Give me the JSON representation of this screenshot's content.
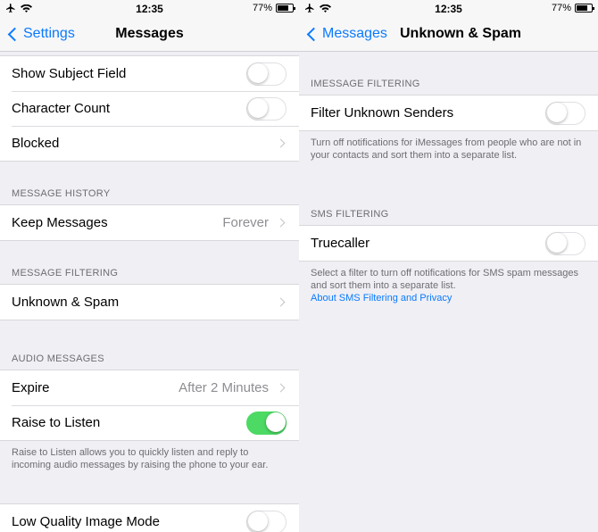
{
  "status_bar": {
    "time": "12:35",
    "battery": "77%",
    "battery_level": 0.77,
    "icons": [
      "airplane-icon",
      "wifi-icon",
      "battery-icon"
    ]
  },
  "left": {
    "nav": {
      "back_label": "Settings",
      "title": "Messages"
    },
    "top_group": [
      {
        "label": "Show Subject Field",
        "control": "toggle",
        "on": false
      },
      {
        "label": "Character Count",
        "control": "toggle",
        "on": false
      },
      {
        "label": "Blocked",
        "control": "chevron"
      }
    ],
    "message_history": {
      "header": "MESSAGE HISTORY",
      "rows": [
        {
          "label": "Keep Messages",
          "value": "Forever",
          "control": "chevron"
        }
      ]
    },
    "message_filtering": {
      "header": "MESSAGE FILTERING",
      "rows": [
        {
          "label": "Unknown & Spam",
          "control": "chevron"
        }
      ]
    },
    "audio_messages": {
      "header": "AUDIO MESSAGES",
      "rows": [
        {
          "label": "Expire",
          "value": "After 2 Minutes",
          "control": "chevron"
        },
        {
          "label": "Raise to Listen",
          "control": "toggle",
          "on": true
        }
      ],
      "footer": "Raise to Listen allows you to quickly listen and reply to incoming audio messages by raising the phone to your ear."
    },
    "bottom_group": [
      {
        "label": "Low Quality Image Mode",
        "control": "toggle",
        "on": false
      }
    ]
  },
  "right": {
    "nav": {
      "back_label": "Messages",
      "title": "Unknown & Spam"
    },
    "imessage_filtering": {
      "header": "IMESSAGE FILTERING",
      "rows": [
        {
          "label": "Filter Unknown Senders",
          "control": "toggle",
          "on": false
        }
      ],
      "footer": "Turn off notifications for iMessages from people who are not in your contacts and sort them into a separate list."
    },
    "sms_filtering": {
      "header": "SMS FILTERING",
      "rows": [
        {
          "label": "Truecaller",
          "control": "toggle",
          "on": false
        }
      ],
      "footer": "Select a filter to turn off notifications for SMS spam messages and sort them into a separate list.",
      "footer_link": "About SMS Filtering and Privacy"
    }
  },
  "colors": {
    "accent": "#0a7aff",
    "toggle_on": "#4cd964",
    "background": "#efeff4",
    "secondary_text": "#8e8e93"
  }
}
